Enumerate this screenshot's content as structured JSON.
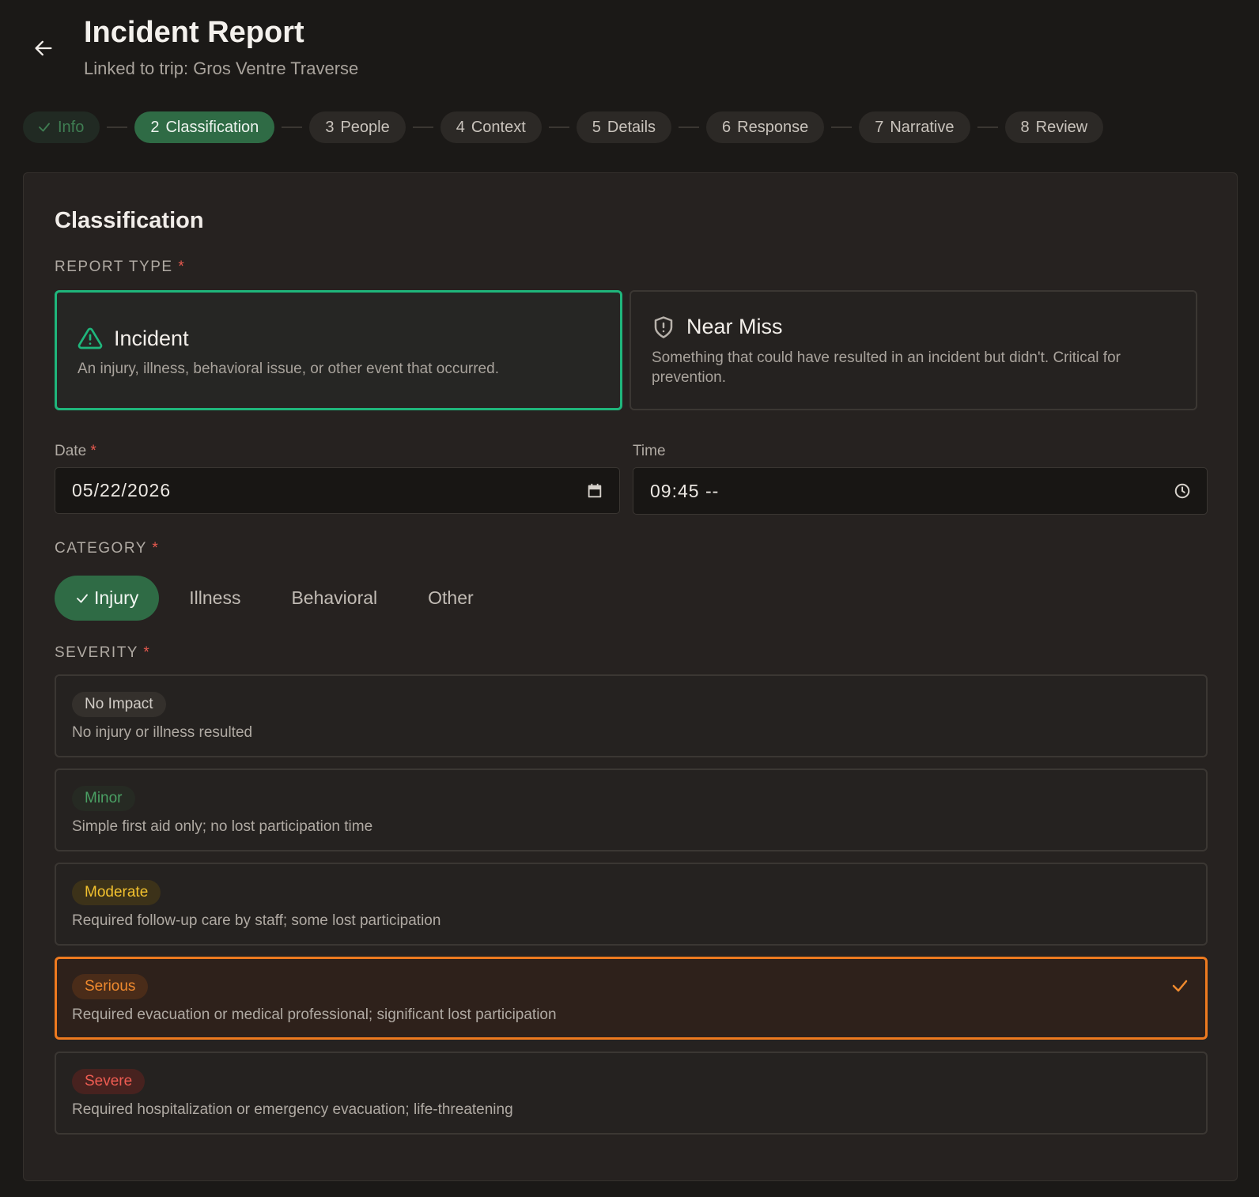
{
  "header": {
    "title": "Incident Report",
    "subtitle": "Linked to trip: Gros Ventre Traverse"
  },
  "steps": [
    {
      "label": "Info",
      "state": "done"
    },
    {
      "number": "2",
      "label": "Classification",
      "state": "active"
    },
    {
      "number": "3",
      "label": "People",
      "state": "pending"
    },
    {
      "number": "4",
      "label": "Context",
      "state": "pending"
    },
    {
      "number": "5",
      "label": "Details",
      "state": "pending"
    },
    {
      "number": "6",
      "label": "Response",
      "state": "pending"
    },
    {
      "number": "7",
      "label": "Narrative",
      "state": "pending"
    },
    {
      "number": "8",
      "label": "Review",
      "state": "pending"
    }
  ],
  "form": {
    "section_title": "Classification",
    "required_marker": "*",
    "report_type": {
      "label": "REPORT TYPE",
      "selected": "incident",
      "options": [
        {
          "id": "incident",
          "icon": "warning-triangle-icon",
          "title": "Incident",
          "description": "An injury, illness, behavioral issue, or other event that occurred."
        },
        {
          "id": "near_miss",
          "icon": "shield-alert-icon",
          "title": "Near Miss",
          "description": "Something that could have resulted in an incident but didn't. Critical for prevention."
        }
      ]
    },
    "date": {
      "label": "Date",
      "value": "05/22/2026",
      "icon": "calendar-icon"
    },
    "time": {
      "label": "Time",
      "value": "09:45 --",
      "icon": "clock-icon"
    },
    "category": {
      "label": "CATEGORY",
      "selected": "Injury",
      "options": [
        "Injury",
        "Illness",
        "Behavioral",
        "Other"
      ]
    },
    "severity": {
      "label": "SEVERITY",
      "selected": "Serious",
      "levels": [
        {
          "name": "No Impact",
          "description": "No injury or illness resulted",
          "color": "#d2cdc7",
          "bg": "#34302c"
        },
        {
          "name": "Minor",
          "description": "Simple first aid only; no lost participation time",
          "color": "#4aa064",
          "bg": "#262a23"
        },
        {
          "name": "Moderate",
          "description": "Required follow-up care by staff; some lost participation",
          "color": "#f2c12e",
          "bg": "#3c3219"
        },
        {
          "name": "Serious",
          "description": "Required evacuation or medical professional; significant lost participation",
          "color": "#f08a2e",
          "bg": "#4a2c19"
        },
        {
          "name": "Severe",
          "description": "Required hospitalization or emergency evacuation; life-threatening",
          "color": "#ee5c52",
          "bg": "#47221f"
        }
      ]
    }
  },
  "colors": {
    "accent_green": "#2f6b45",
    "selected_border_green": "#1fb67c",
    "selected_border_orange": "#ee7a1f",
    "required_red": "#e85a4f"
  }
}
